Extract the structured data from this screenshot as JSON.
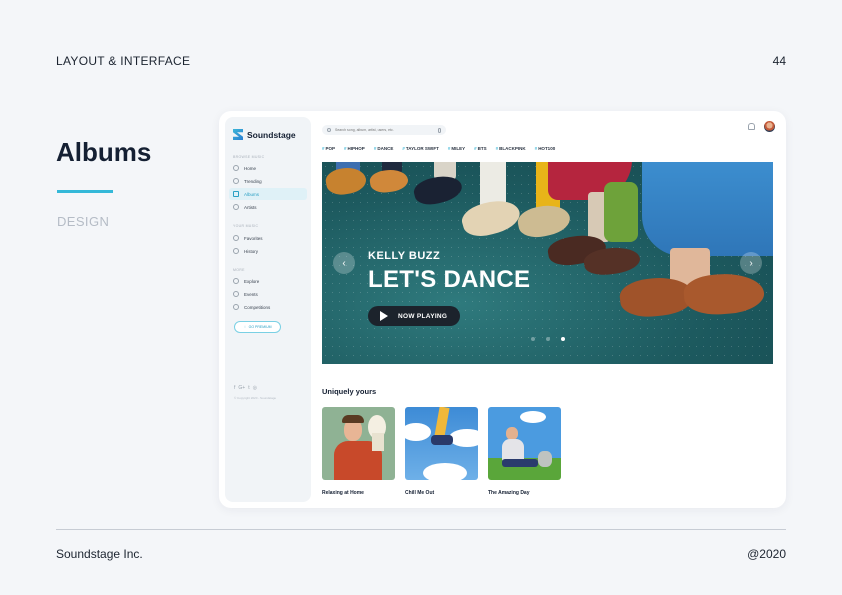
{
  "slide": {
    "header_label": "LAYOUT & INTERFACE",
    "page_number": "44",
    "title": "Albums",
    "subtitle": "DESIGN",
    "accent_color": "#34b8d8",
    "footer_company": "Soundstage Inc.",
    "footer_year": "@2020"
  },
  "app": {
    "brand": "Soundstage",
    "search_placeholder": "Search song, album, artist, users, etc.",
    "sidebar": {
      "browse_heading": "BROWSE MUSIC",
      "browse_items": [
        {
          "label": "Home",
          "icon": "home-icon"
        },
        {
          "label": "Trending",
          "icon": "star-icon"
        },
        {
          "label": "Albums",
          "icon": "album-icon",
          "active": true
        },
        {
          "label": "Artists",
          "icon": "user-icon"
        }
      ],
      "yours_heading": "YOUR MUSIC",
      "yours_items": [
        {
          "label": "Favorites",
          "icon": "heart-icon"
        },
        {
          "label": "History",
          "icon": "clock-icon"
        }
      ],
      "more_heading": "MORE",
      "more_items": [
        {
          "label": "Explore",
          "icon": "compass-icon"
        },
        {
          "label": "Events",
          "icon": "calendar-icon"
        },
        {
          "label": "Competitions",
          "icon": "trophy-icon"
        }
      ],
      "premium_label": "GO PREMIUM",
      "social": [
        "f",
        "G+",
        "t",
        "◎"
      ],
      "copyright": "© Copyright 2020 - Soundstage"
    },
    "tags": [
      "POP",
      "HIPHOP",
      "DANCE",
      "TAYLOR SWIFT",
      "MILEY",
      "BTS",
      "BLACKPINK",
      "HOT100"
    ],
    "banner": {
      "artist": "KELLY BUZZ",
      "title": "LET'S DANCE",
      "play_label": "NOW PLAYING",
      "prev_arrow": "‹",
      "next_arrow": "›",
      "active_dot": 3,
      "dot_count": 3
    },
    "section_title": "Uniquely yours",
    "albums": [
      {
        "label": "Relaxing at Home"
      },
      {
        "label": "Chill Me Out"
      },
      {
        "label": "The Amazing Day"
      }
    ]
  }
}
